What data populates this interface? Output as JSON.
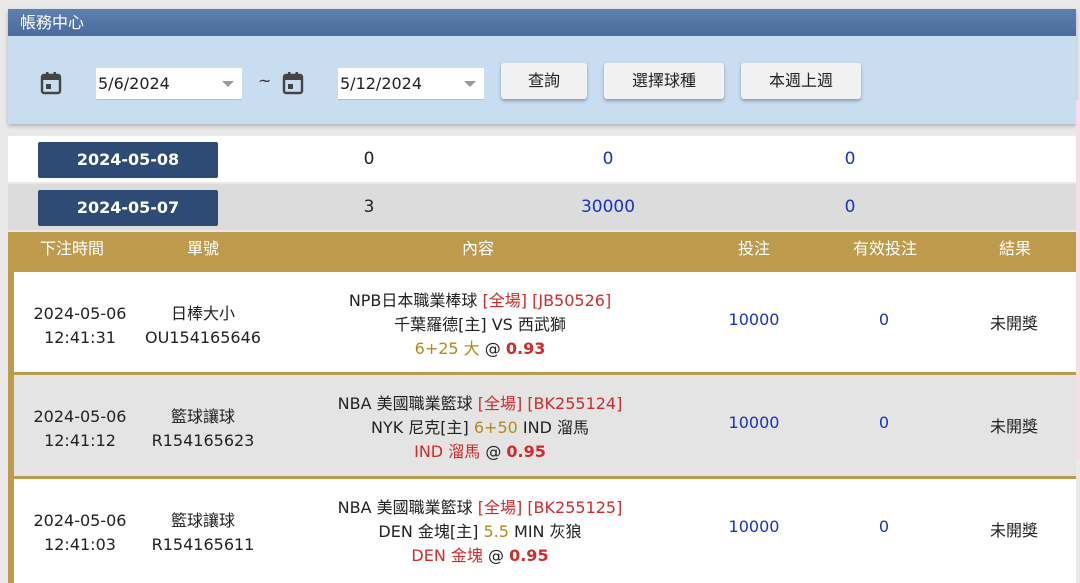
{
  "panel": {
    "title": "帳務中心",
    "start_date": "5/6/2024",
    "tilde": "~",
    "end_date": "5/12/2024",
    "buttons": {
      "query": "查詢",
      "select_sport": "選擇球種",
      "week": "本週上週"
    }
  },
  "summary_rows": [
    {
      "date": "2024-05-08",
      "count": "0",
      "amount": "0",
      "valid": "0"
    },
    {
      "date": "2024-05-07",
      "count": "3",
      "amount": "30000",
      "valid": "0"
    }
  ],
  "table": {
    "headers": {
      "time": "下注時間",
      "ticket": "單號",
      "content": "內容",
      "stake": "投注",
      "valid": "有效投注",
      "result": "結果"
    },
    "rows": [
      {
        "date": "2024-05-06",
        "time": "12:41:31",
        "type": "日棒大小",
        "ticket": "OU154165646",
        "league": "NPB日本職業棒球",
        "period": "[全場]",
        "code": "[JB50526]",
        "home": "千葉羅德[主]",
        "mid": "VS",
        "away": "西武獅",
        "pick": "6+25 大",
        "at": "@",
        "odds": "0.93",
        "stake": "10000",
        "valid": "0",
        "result": "未開獎"
      },
      {
        "date": "2024-05-06",
        "time": "12:41:12",
        "type": "籃球讓球",
        "ticket": "R154165623",
        "league": "NBA 美國職業籃球",
        "period": "[全場]",
        "code": "[BK255124]",
        "home": "NYK 尼克[主]",
        "mid": "6+50",
        "away": "IND 溜馬",
        "pick": "IND 溜馬",
        "at": "@",
        "odds": "0.95",
        "stake": "10000",
        "valid": "0",
        "result": "未開獎"
      },
      {
        "date": "2024-05-06",
        "time": "12:41:03",
        "type": "籃球讓球",
        "ticket": "R154165611",
        "league": "NBA 美國職業籃球",
        "period": "[全場]",
        "code": "[BK255125]",
        "home": "DEN 金塊[主]",
        "mid": "5.5",
        "away": "MIN 灰狼",
        "pick": "DEN 金塊",
        "at": "@",
        "odds": "0.95",
        "stake": "10000",
        "valid": "0",
        "result": "未開獎"
      }
    ]
  }
}
